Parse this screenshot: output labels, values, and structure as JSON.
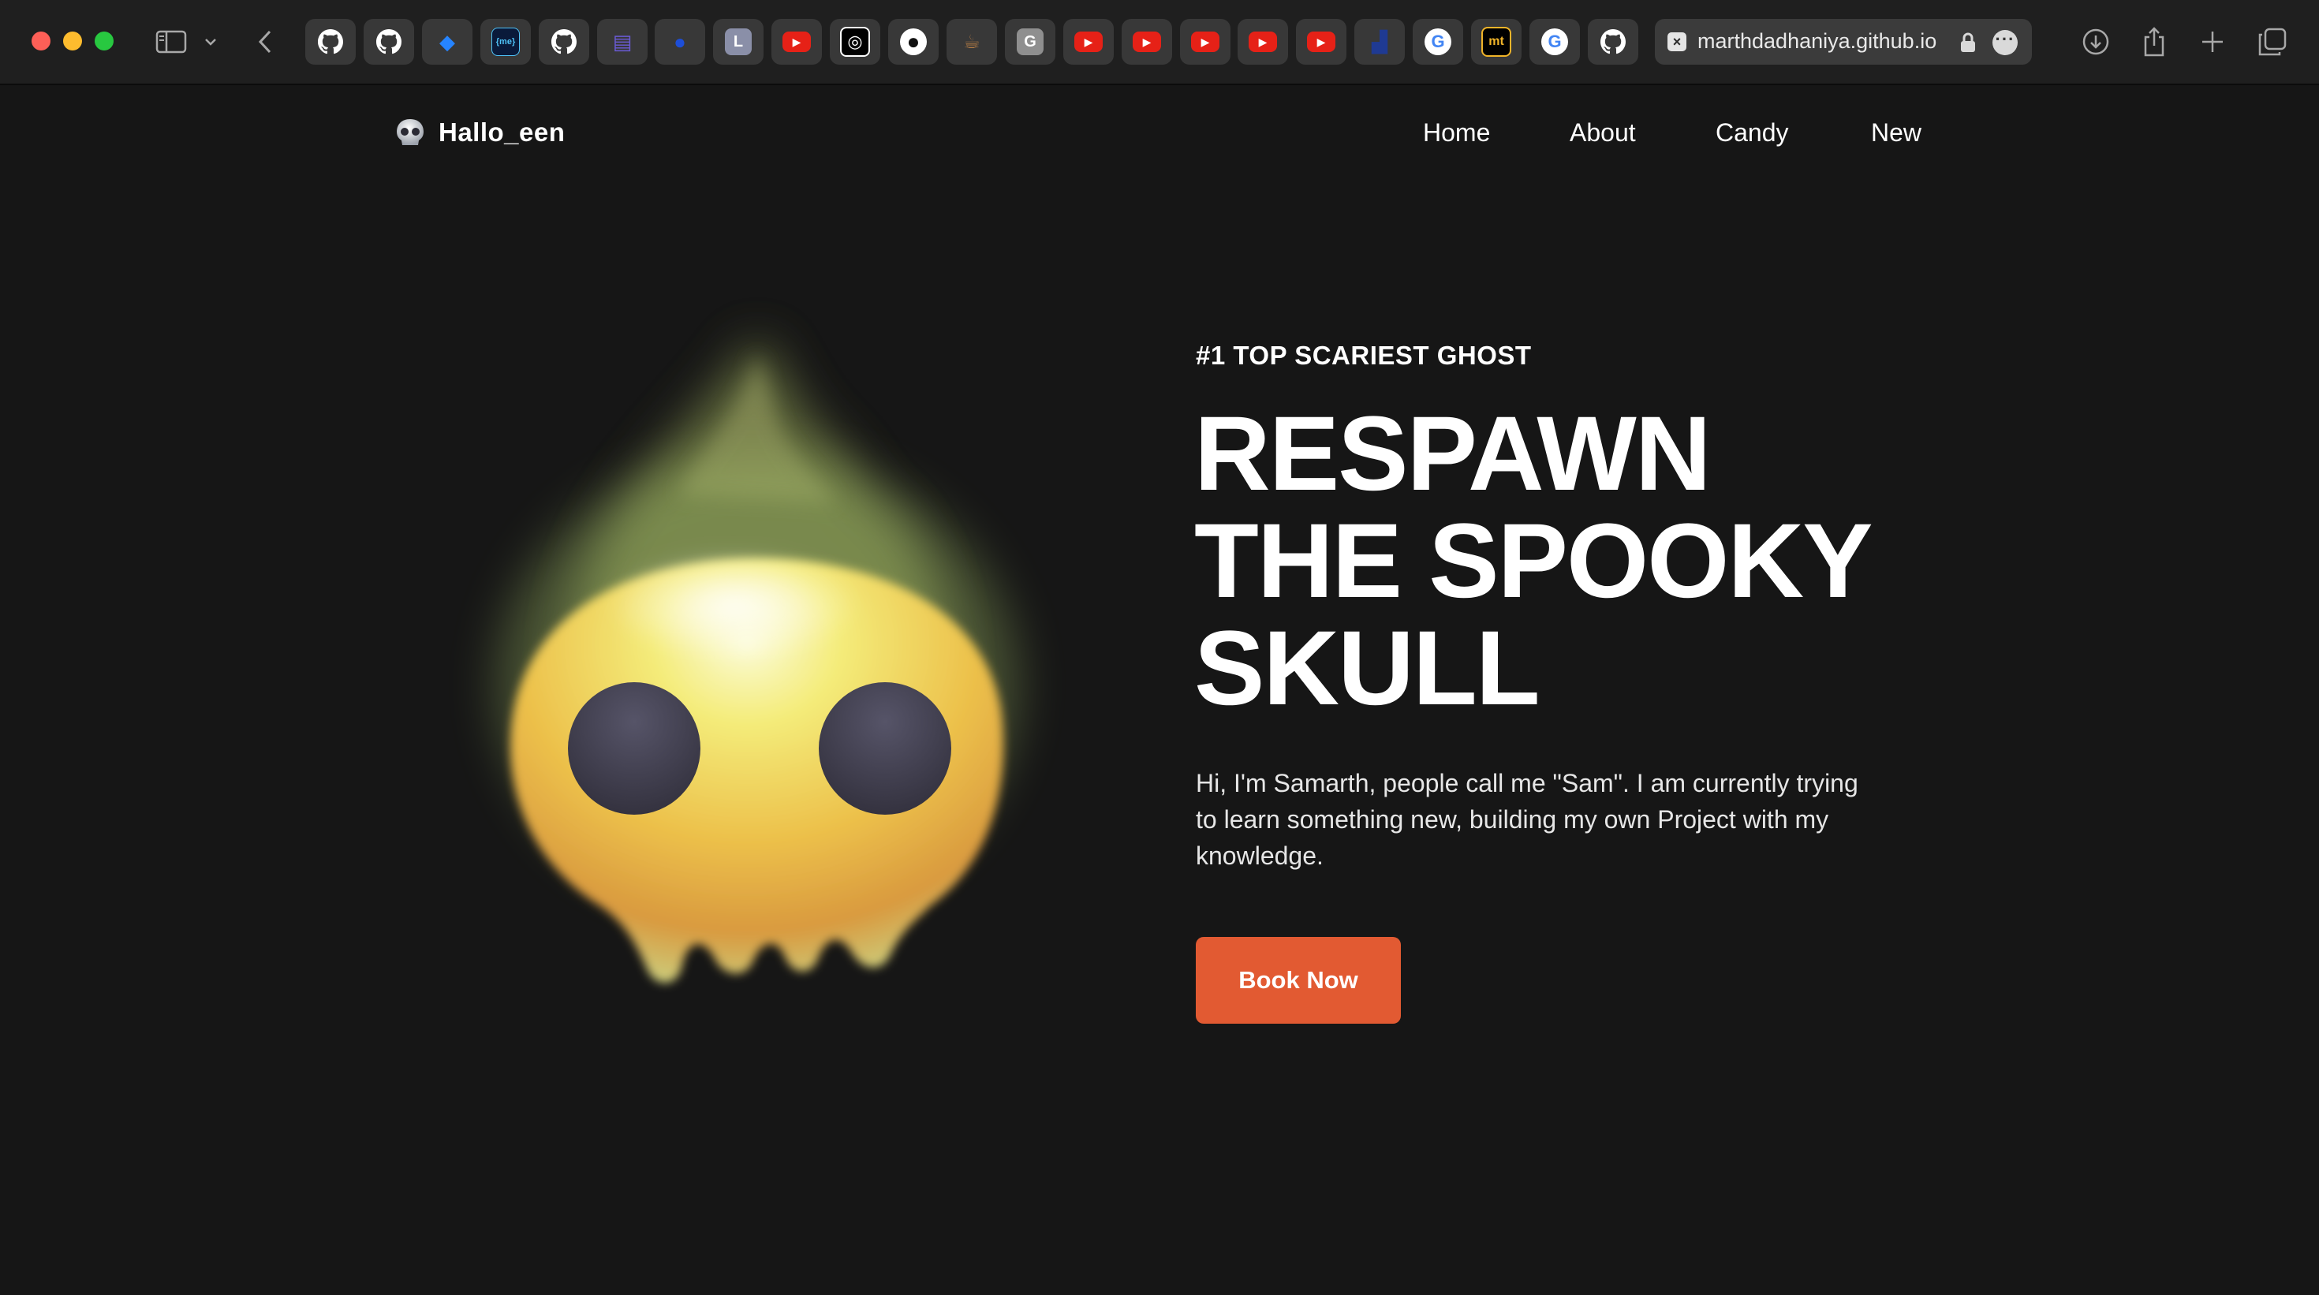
{
  "browser": {
    "url": "marthdadhaniya.github.io",
    "tabs": [
      {
        "icon": "github-icon",
        "color": "#ffffff",
        "glyph": ""
      },
      {
        "icon": "github-icon",
        "color": "#ffffff",
        "glyph": ""
      },
      {
        "icon": "jira-icon",
        "color": "#2684ff",
        "glyph": "◆"
      },
      {
        "icon": "bio-link-icon",
        "color": "#0a1a3a",
        "glyph": "{me}"
      },
      {
        "icon": "github-icon",
        "color": "#ffffff",
        "glyph": ""
      },
      {
        "icon": "printer-app-icon",
        "color": "#6b5bd6",
        "glyph": "▤"
      },
      {
        "icon": "blue-circle-app-icon",
        "color": "#1d4ed8",
        "glyph": "●"
      },
      {
        "icon": "letter-l-icon",
        "color": "#8a8fa8",
        "glyph": "L"
      },
      {
        "icon": "youtube-icon",
        "color": "#e62117",
        "glyph": "▶"
      },
      {
        "icon": "openai-icon",
        "color": "#ffffff",
        "glyph": "◎"
      },
      {
        "icon": "dark-circle-icon",
        "color": "#ffffff",
        "glyph": "●"
      },
      {
        "icon": "coffee-icon",
        "color": "#b07a45",
        "glyph": "☕"
      },
      {
        "icon": "letter-g-icon",
        "color": "#8f8f8f",
        "glyph": "G"
      },
      {
        "icon": "youtube-icon",
        "color": "#e62117",
        "glyph": "▶"
      },
      {
        "icon": "youtube-icon",
        "color": "#e62117",
        "glyph": "▶"
      },
      {
        "icon": "youtube-icon",
        "color": "#e62117",
        "glyph": "▶"
      },
      {
        "icon": "youtube-icon",
        "color": "#e62117",
        "glyph": "▶"
      },
      {
        "icon": "youtube-icon",
        "color": "#e62117",
        "glyph": "▶"
      },
      {
        "icon": "chart-app-icon",
        "color": "#1f3a93",
        "glyph": "▟"
      },
      {
        "icon": "google-icon",
        "color": "#ffffff",
        "glyph": "G"
      },
      {
        "icon": "mt-icon",
        "color": "#f0b429",
        "glyph": "mt"
      },
      {
        "icon": "google-icon",
        "color": "#ffffff",
        "glyph": "G"
      },
      {
        "icon": "github-icon",
        "color": "#ffffff",
        "glyph": ""
      }
    ]
  },
  "site": {
    "brand": "Hallo_een",
    "nav": {
      "home": "Home",
      "about": "About",
      "candy": "Candy",
      "new": "New"
    },
    "hero": {
      "tagline": "#1 TOP SCARIEST GHOST",
      "headline": [
        "RESPAWN",
        "THE SPOOKY",
        "SKULL"
      ],
      "description": "Hi, I'm Samarth, people call me \"Sam\". I am currently trying to learn something new, building my own Project with my knowledge.",
      "cta": "Book Now"
    },
    "colors": {
      "accent": "#e25a32",
      "background": "#161616"
    }
  }
}
